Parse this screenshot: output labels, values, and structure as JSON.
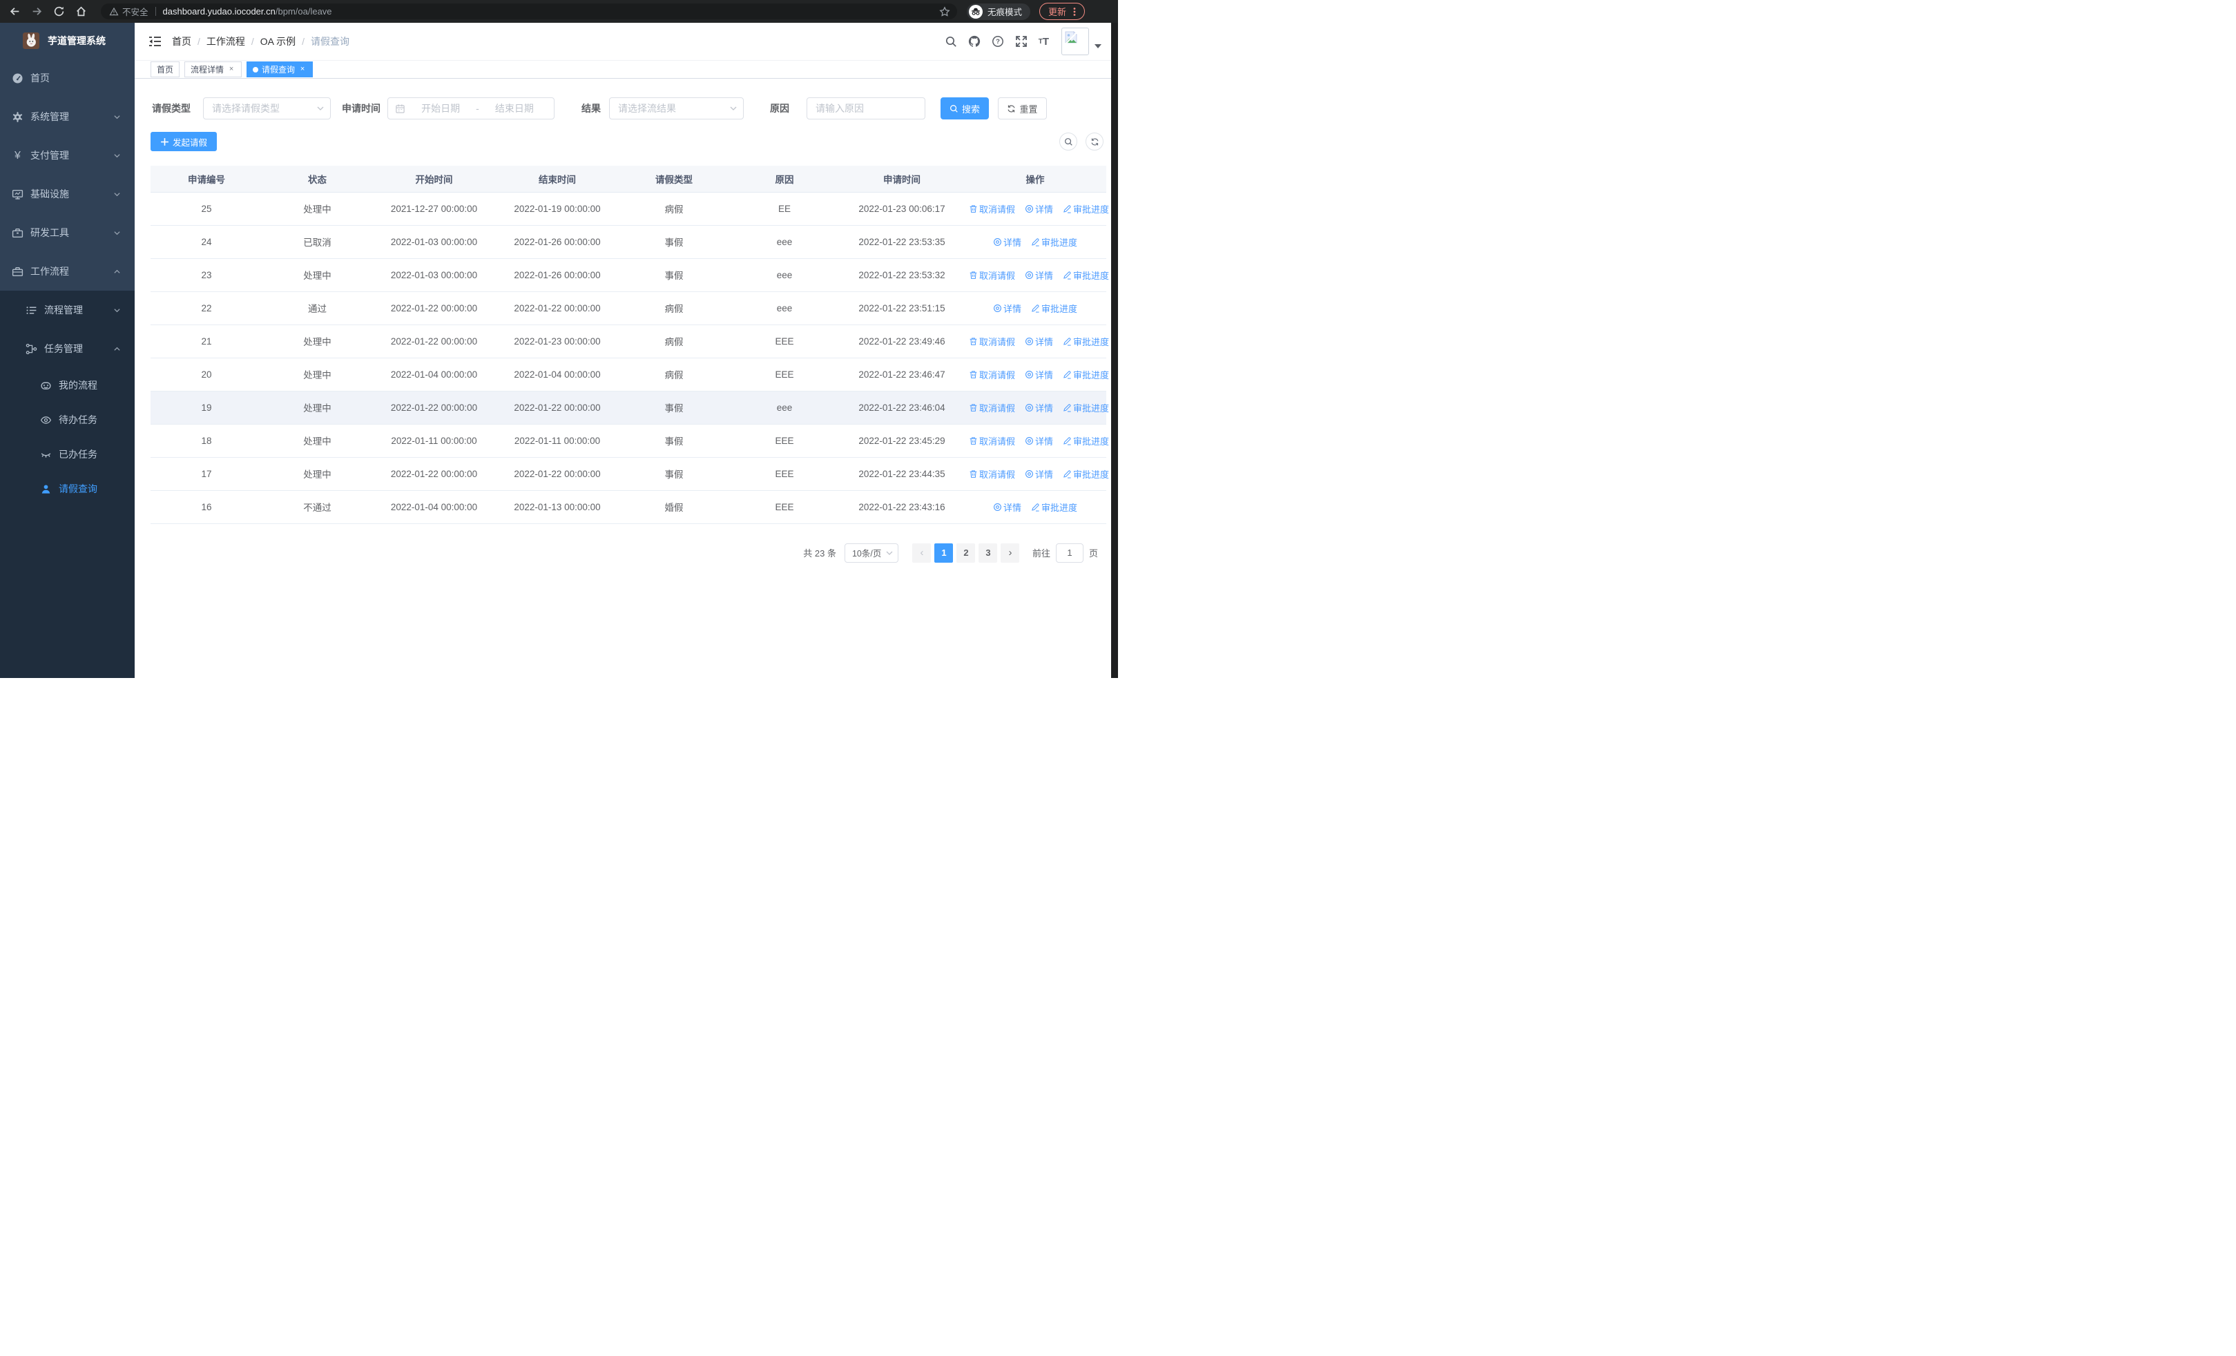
{
  "browser": {
    "security_label": "不安全",
    "url_host": "dashboard.yudao.iocoder.cn",
    "url_path": "/bpm/oa/leave",
    "incognito_label": "无痕模式",
    "update_label": "更新"
  },
  "colors": {
    "primary": "#409eff",
    "sidebar_bg": "#304156",
    "submenu_bg": "#1f2d3d",
    "link_blue": "#4c9bff",
    "update_accent": "#f28b82"
  },
  "sidebar": {
    "title": "芋道管理系统",
    "logo_icon": "rabbit-logo",
    "menu": [
      {
        "label": "首页",
        "icon": "dashboard-icon",
        "level": 0
      },
      {
        "label": "系统管理",
        "icon": "gear-icon",
        "level": 0,
        "chevron": "down"
      },
      {
        "label": "支付管理",
        "icon": "yen-icon",
        "level": 0,
        "chevron": "down"
      },
      {
        "label": "基础设施",
        "icon": "monitor-icon",
        "level": 0,
        "chevron": "down"
      },
      {
        "label": "研发工具",
        "icon": "toolbox-icon",
        "level": 0,
        "chevron": "down"
      },
      {
        "label": "工作流程",
        "icon": "briefcase-icon",
        "level": 0,
        "chevron": "up"
      },
      {
        "label": "流程管理",
        "icon": "list-icon",
        "level": 1,
        "chevron": "down",
        "dark": true
      },
      {
        "label": "任务管理",
        "icon": "flow-icon",
        "level": 1,
        "chevron": "up",
        "dark": true
      },
      {
        "label": "我的流程",
        "icon": "robot-icon",
        "level": 2,
        "dark": true
      },
      {
        "label": "待办任务",
        "icon": "eye-icon",
        "level": 2,
        "dark": true
      },
      {
        "label": "已办任务",
        "icon": "eye-closed-icon",
        "level": 2,
        "dark": true
      },
      {
        "label": "请假查询",
        "icon": "user-icon",
        "level": 2,
        "dark": true,
        "active": true
      }
    ]
  },
  "breadcrumb": [
    "首页",
    "工作流程",
    "OA 示例",
    "请假查询"
  ],
  "tabs": [
    {
      "label": "首页",
      "closable": false,
      "active": false
    },
    {
      "label": "流程详情",
      "closable": true,
      "active": false
    },
    {
      "label": "请假查询",
      "closable": true,
      "active": true
    }
  ],
  "filters": {
    "leave_type_label": "请假类型",
    "leave_type_placeholder": "请选择请假类型",
    "apply_time_label": "申请时间",
    "start_date_placeholder": "开始日期",
    "date_separator": "-",
    "end_date_placeholder": "结束日期",
    "result_label": "结果",
    "result_placeholder": "请选择流结果",
    "reason_label": "原因",
    "reason_placeholder": "请输入原因",
    "search_button": "搜索",
    "reset_button": "重置"
  },
  "toolbar": {
    "create_button": "发起请假"
  },
  "table": {
    "columns": [
      "申请编号",
      "状态",
      "开始时间",
      "结束时间",
      "请假类型",
      "原因",
      "申请时间",
      "操作"
    ],
    "action_defs": {
      "cancel": {
        "label": "取消请假",
        "icon": "trash-icon"
      },
      "view": {
        "label": "详情",
        "icon": "view-icon"
      },
      "progress": {
        "label": "审批进度",
        "icon": "edit-icon"
      }
    },
    "rows": [
      {
        "id": "25",
        "status": "处理中",
        "start": "2021-12-27 00:00:00",
        "end": "2022-01-19 00:00:00",
        "type": "病假",
        "reason": "EE",
        "applied": "2022-01-23 00:06:17",
        "actions": [
          "cancel",
          "view",
          "progress"
        ],
        "highlight": false
      },
      {
        "id": "24",
        "status": "已取消",
        "start": "2022-01-03 00:00:00",
        "end": "2022-01-26 00:00:00",
        "type": "事假",
        "reason": "eee",
        "applied": "2022-01-22 23:53:35",
        "actions": [
          "view",
          "progress"
        ],
        "highlight": false
      },
      {
        "id": "23",
        "status": "处理中",
        "start": "2022-01-03 00:00:00",
        "end": "2022-01-26 00:00:00",
        "type": "事假",
        "reason": "eee",
        "applied": "2022-01-22 23:53:32",
        "actions": [
          "cancel",
          "view",
          "progress"
        ],
        "highlight": false
      },
      {
        "id": "22",
        "status": "通过",
        "start": "2022-01-22 00:00:00",
        "end": "2022-01-22 00:00:00",
        "type": "病假",
        "reason": "eee",
        "applied": "2022-01-22 23:51:15",
        "actions": [
          "view",
          "progress"
        ],
        "highlight": false
      },
      {
        "id": "21",
        "status": "处理中",
        "start": "2022-01-22 00:00:00",
        "end": "2022-01-23 00:00:00",
        "type": "病假",
        "reason": "EEE",
        "applied": "2022-01-22 23:49:46",
        "actions": [
          "cancel",
          "view",
          "progress"
        ],
        "highlight": false
      },
      {
        "id": "20",
        "status": "处理中",
        "start": "2022-01-04 00:00:00",
        "end": "2022-01-04 00:00:00",
        "type": "病假",
        "reason": "EEE",
        "applied": "2022-01-22 23:46:47",
        "actions": [
          "cancel",
          "view",
          "progress"
        ],
        "highlight": false
      },
      {
        "id": "19",
        "status": "处理中",
        "start": "2022-01-22 00:00:00",
        "end": "2022-01-22 00:00:00",
        "type": "事假",
        "reason": "eee",
        "applied": "2022-01-22 23:46:04",
        "actions": [
          "cancel",
          "view",
          "progress"
        ],
        "highlight": true
      },
      {
        "id": "18",
        "status": "处理中",
        "start": "2022-01-11 00:00:00",
        "end": "2022-01-11 00:00:00",
        "type": "事假",
        "reason": "EEE",
        "applied": "2022-01-22 23:45:29",
        "actions": [
          "cancel",
          "view",
          "progress"
        ],
        "highlight": false
      },
      {
        "id": "17",
        "status": "处理中",
        "start": "2022-01-22 00:00:00",
        "end": "2022-01-22 00:00:00",
        "type": "事假",
        "reason": "EEE",
        "applied": "2022-01-22 23:44:35",
        "actions": [
          "cancel",
          "view",
          "progress"
        ],
        "highlight": false
      },
      {
        "id": "16",
        "status": "不通过",
        "start": "2022-01-04 00:00:00",
        "end": "2022-01-13 00:00:00",
        "type": "婚假",
        "reason": "EEE",
        "applied": "2022-01-22 23:43:16",
        "actions": [
          "view",
          "progress"
        ],
        "highlight": false
      }
    ]
  },
  "pagination": {
    "total_label": "共 23 条",
    "page_size_label": "10条/页",
    "pages": [
      "1",
      "2",
      "3"
    ],
    "active_page": "1",
    "goto_label": "前往",
    "goto_value": "1",
    "goto_unit": "页"
  }
}
